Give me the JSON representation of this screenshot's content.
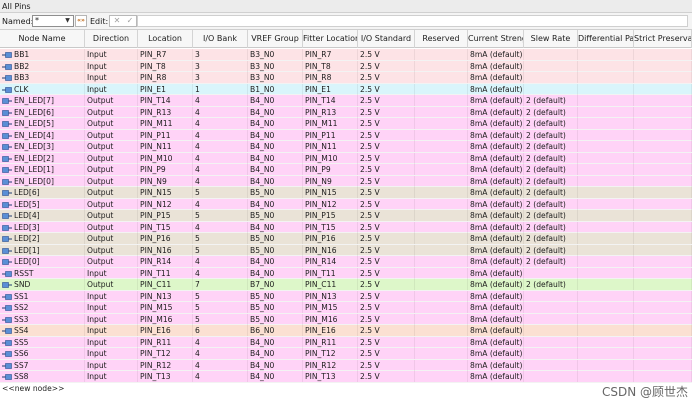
{
  "window": {
    "title": "All Pins"
  },
  "toolbar": {
    "named_label": "Named:",
    "named_value": "*",
    "filter_glyph": "«»",
    "edit_label": "Edit:",
    "cancel_glyph": "✕",
    "accept_glyph": "✓"
  },
  "colors": {
    "Input_B3": "#fde3e6",
    "Input_B1": "#d9f5fb",
    "Output_B4": "#ffd3f7",
    "Output_B5": "#eae3d7",
    "Input_B4": "#ffd3f7",
    "Output_B7": "#ddf7c9",
    "Input_B5": "#ffd3f7",
    "Input_B6": "#fbe0d2"
  },
  "columns": [
    "Node Name",
    "Direction",
    "Location",
    "I/O Bank",
    "VREF Group",
    "Fitter Location",
    "I/O Standard",
    "Reserved",
    "Current Strength",
    "Slew Rate",
    "Differential Pair",
    "Strict Preservation"
  ],
  "rows": [
    {
      "name": "BB1",
      "direction": "Input",
      "location": "PIN_R7",
      "bank": "3",
      "vref": "B3_N0",
      "fitter": "PIN_R7",
      "standard": "2.5 V",
      "reserved": "",
      "strength": "8mA (default)",
      "slew": "",
      "diff": "",
      "strict": "",
      "color": "Input_B3",
      "icon": "input-pin-icon"
    },
    {
      "name": "BB2",
      "direction": "Input",
      "location": "PIN_T8",
      "bank": "3",
      "vref": "B3_N0",
      "fitter": "PIN_T8",
      "standard": "2.5 V",
      "reserved": "",
      "strength": "8mA (default)",
      "slew": "",
      "diff": "",
      "strict": "",
      "color": "Input_B3",
      "icon": "input-pin-icon"
    },
    {
      "name": "BB3",
      "direction": "Input",
      "location": "PIN_R8",
      "bank": "3",
      "vref": "B3_N0",
      "fitter": "PIN_R8",
      "standard": "2.5 V",
      "reserved": "",
      "strength": "8mA (default)",
      "slew": "",
      "diff": "",
      "strict": "",
      "color": "Input_B3",
      "icon": "input-pin-icon"
    },
    {
      "name": "CLK",
      "direction": "Input",
      "location": "PIN_E1",
      "bank": "1",
      "vref": "B1_N0",
      "fitter": "PIN_E1",
      "standard": "2.5 V",
      "reserved": "",
      "strength": "8mA (default)",
      "slew": "",
      "diff": "",
      "strict": "",
      "color": "Input_B1",
      "icon": "input-pin-icon"
    },
    {
      "name": "EN_LED[7]",
      "direction": "Output",
      "location": "PIN_T14",
      "bank": "4",
      "vref": "B4_N0",
      "fitter": "PIN_T14",
      "standard": "2.5 V",
      "reserved": "",
      "strength": "8mA (default)",
      "slew": "2 (default)",
      "diff": "",
      "strict": "",
      "color": "Output_B4",
      "icon": "output-pin-icon"
    },
    {
      "name": "EN_LED[6]",
      "direction": "Output",
      "location": "PIN_R13",
      "bank": "4",
      "vref": "B4_N0",
      "fitter": "PIN_R13",
      "standard": "2.5 V",
      "reserved": "",
      "strength": "8mA (default)",
      "slew": "2 (default)",
      "diff": "",
      "strict": "",
      "color": "Output_B4",
      "icon": "output-pin-icon"
    },
    {
      "name": "EN_LED[5]",
      "direction": "Output",
      "location": "PIN_M11",
      "bank": "4",
      "vref": "B4_N0",
      "fitter": "PIN_M11",
      "standard": "2.5 V",
      "reserved": "",
      "strength": "8mA (default)",
      "slew": "2 (default)",
      "diff": "",
      "strict": "",
      "color": "Output_B4",
      "icon": "output-pin-icon"
    },
    {
      "name": "EN_LED[4]",
      "direction": "Output",
      "location": "PIN_P11",
      "bank": "4",
      "vref": "B4_N0",
      "fitter": "PIN_P11",
      "standard": "2.5 V",
      "reserved": "",
      "strength": "8mA (default)",
      "slew": "2 (default)",
      "diff": "",
      "strict": "",
      "color": "Output_B4",
      "icon": "output-pin-icon"
    },
    {
      "name": "EN_LED[3]",
      "direction": "Output",
      "location": "PIN_N11",
      "bank": "4",
      "vref": "B4_N0",
      "fitter": "PIN_N11",
      "standard": "2.5 V",
      "reserved": "",
      "strength": "8mA (default)",
      "slew": "2 (default)",
      "diff": "",
      "strict": "",
      "color": "Output_B4",
      "icon": "output-pin-icon"
    },
    {
      "name": "EN_LED[2]",
      "direction": "Output",
      "location": "PIN_M10",
      "bank": "4",
      "vref": "B4_N0",
      "fitter": "PIN_M10",
      "standard": "2.5 V",
      "reserved": "",
      "strength": "8mA (default)",
      "slew": "2 (default)",
      "diff": "",
      "strict": "",
      "color": "Output_B4",
      "icon": "output-pin-icon"
    },
    {
      "name": "EN_LED[1]",
      "direction": "Output",
      "location": "PIN_P9",
      "bank": "4",
      "vref": "B4_N0",
      "fitter": "PIN_P9",
      "standard": "2.5 V",
      "reserved": "",
      "strength": "8mA (default)",
      "slew": "2 (default)",
      "diff": "",
      "strict": "",
      "color": "Output_B4",
      "icon": "output-pin-icon"
    },
    {
      "name": "EN_LED[0]",
      "direction": "Output",
      "location": "PIN_N9",
      "bank": "4",
      "vref": "B4_N0",
      "fitter": "PIN_N9",
      "standard": "2.5 V",
      "reserved": "",
      "strength": "8mA (default)",
      "slew": "2 (default)",
      "diff": "",
      "strict": "",
      "color": "Output_B4",
      "icon": "output-pin-icon"
    },
    {
      "name": "LED[6]",
      "direction": "Output",
      "location": "PIN_N15",
      "bank": "5",
      "vref": "B5_N0",
      "fitter": "PIN_N15",
      "standard": "2.5 V",
      "reserved": "",
      "strength": "8mA (default)",
      "slew": "2 (default)",
      "diff": "",
      "strict": "",
      "color": "Output_B5",
      "icon": "output-pin-icon"
    },
    {
      "name": "LED[5]",
      "direction": "Output",
      "location": "PIN_N12",
      "bank": "4",
      "vref": "B4_N0",
      "fitter": "PIN_N12",
      "standard": "2.5 V",
      "reserved": "",
      "strength": "8mA (default)",
      "slew": "2 (default)",
      "diff": "",
      "strict": "",
      "color": "Output_B4",
      "icon": "output-pin-icon"
    },
    {
      "name": "LED[4]",
      "direction": "Output",
      "location": "PIN_P15",
      "bank": "5",
      "vref": "B5_N0",
      "fitter": "PIN_P15",
      "standard": "2.5 V",
      "reserved": "",
      "strength": "8mA (default)",
      "slew": "2 (default)",
      "diff": "",
      "strict": "",
      "color": "Output_B5",
      "icon": "output-pin-icon"
    },
    {
      "name": "LED[3]",
      "direction": "Output",
      "location": "PIN_T15",
      "bank": "4",
      "vref": "B4_N0",
      "fitter": "PIN_T15",
      "standard": "2.5 V",
      "reserved": "",
      "strength": "8mA (default)",
      "slew": "2 (default)",
      "diff": "",
      "strict": "",
      "color": "Output_B4",
      "icon": "output-pin-icon"
    },
    {
      "name": "LED[2]",
      "direction": "Output",
      "location": "PIN_P16",
      "bank": "5",
      "vref": "B5_N0",
      "fitter": "PIN_P16",
      "standard": "2.5 V",
      "reserved": "",
      "strength": "8mA (default)",
      "slew": "2 (default)",
      "diff": "",
      "strict": "",
      "color": "Output_B5",
      "icon": "output-pin-icon"
    },
    {
      "name": "LED[1]",
      "direction": "Output",
      "location": "PIN_N16",
      "bank": "5",
      "vref": "B5_N0",
      "fitter": "PIN_N16",
      "standard": "2.5 V",
      "reserved": "",
      "strength": "8mA (default)",
      "slew": "2 (default)",
      "diff": "",
      "strict": "",
      "color": "Output_B5",
      "icon": "output-pin-icon"
    },
    {
      "name": "LED[0]",
      "direction": "Output",
      "location": "PIN_R14",
      "bank": "4",
      "vref": "B4_N0",
      "fitter": "PIN_R14",
      "standard": "2.5 V",
      "reserved": "",
      "strength": "8mA (default)",
      "slew": "2 (default)",
      "diff": "",
      "strict": "",
      "color": "Output_B4",
      "icon": "output-pin-icon"
    },
    {
      "name": "RSST",
      "direction": "Input",
      "location": "PIN_T11",
      "bank": "4",
      "vref": "B4_N0",
      "fitter": "PIN_T11",
      "standard": "2.5 V",
      "reserved": "",
      "strength": "8mA (default)",
      "slew": "",
      "diff": "",
      "strict": "",
      "color": "Input_B4",
      "icon": "input-pin-icon"
    },
    {
      "name": "SND",
      "direction": "Output",
      "location": "PIN_C11",
      "bank": "7",
      "vref": "B7_N0",
      "fitter": "PIN_C11",
      "standard": "2.5 V",
      "reserved": "",
      "strength": "8mA (default)",
      "slew": "2 (default)",
      "diff": "",
      "strict": "",
      "color": "Output_B7",
      "icon": "output-pin-icon"
    },
    {
      "name": "SS1",
      "direction": "Input",
      "location": "PIN_N13",
      "bank": "5",
      "vref": "B5_N0",
      "fitter": "PIN_N13",
      "standard": "2.5 V",
      "reserved": "",
      "strength": "8mA (default)",
      "slew": "",
      "diff": "",
      "strict": "",
      "color": "Input_B5",
      "icon": "input-pin-icon"
    },
    {
      "name": "SS2",
      "direction": "Input",
      "location": "PIN_M15",
      "bank": "5",
      "vref": "B5_N0",
      "fitter": "PIN_M15",
      "standard": "2.5 V",
      "reserved": "",
      "strength": "8mA (default)",
      "slew": "",
      "diff": "",
      "strict": "",
      "color": "Input_B5",
      "icon": "input-pin-icon"
    },
    {
      "name": "SS3",
      "direction": "Input",
      "location": "PIN_M16",
      "bank": "5",
      "vref": "B5_N0",
      "fitter": "PIN_M16",
      "standard": "2.5 V",
      "reserved": "",
      "strength": "8mA (default)",
      "slew": "",
      "diff": "",
      "strict": "",
      "color": "Input_B5",
      "icon": "input-pin-icon"
    },
    {
      "name": "SS4",
      "direction": "Input",
      "location": "PIN_E16",
      "bank": "6",
      "vref": "B6_N0",
      "fitter": "PIN_E16",
      "standard": "2.5 V",
      "reserved": "",
      "strength": "8mA (default)",
      "slew": "",
      "diff": "",
      "strict": "",
      "color": "Input_B6",
      "icon": "input-pin-icon"
    },
    {
      "name": "SS5",
      "direction": "Input",
      "location": "PIN_R11",
      "bank": "4",
      "vref": "B4_N0",
      "fitter": "PIN_R11",
      "standard": "2.5 V",
      "reserved": "",
      "strength": "8mA (default)",
      "slew": "",
      "diff": "",
      "strict": "",
      "color": "Input_B4",
      "icon": "input-pin-icon"
    },
    {
      "name": "SS6",
      "direction": "Input",
      "location": "PIN_T12",
      "bank": "4",
      "vref": "B4_N0",
      "fitter": "PIN_T12",
      "standard": "2.5 V",
      "reserved": "",
      "strength": "8mA (default)",
      "slew": "",
      "diff": "",
      "strict": "",
      "color": "Input_B4",
      "icon": "input-pin-icon"
    },
    {
      "name": "SS7",
      "direction": "Input",
      "location": "PIN_R12",
      "bank": "4",
      "vref": "B4_N0",
      "fitter": "PIN_R12",
      "standard": "2.5 V",
      "reserved": "",
      "strength": "8mA (default)",
      "slew": "",
      "diff": "",
      "strict": "",
      "color": "Input_B4",
      "icon": "input-pin-icon"
    },
    {
      "name": "SS8",
      "direction": "Input",
      "location": "PIN_T13",
      "bank": "4",
      "vref": "B4_N0",
      "fitter": "PIN_T13",
      "standard": "2.5 V",
      "reserved": "",
      "strength": "8mA (default)",
      "slew": "",
      "diff": "",
      "strict": "",
      "color": "Input_B4",
      "icon": "input-pin-icon"
    }
  ],
  "new_node": "<<new node>>",
  "watermark": "CSDN @顾世杰"
}
